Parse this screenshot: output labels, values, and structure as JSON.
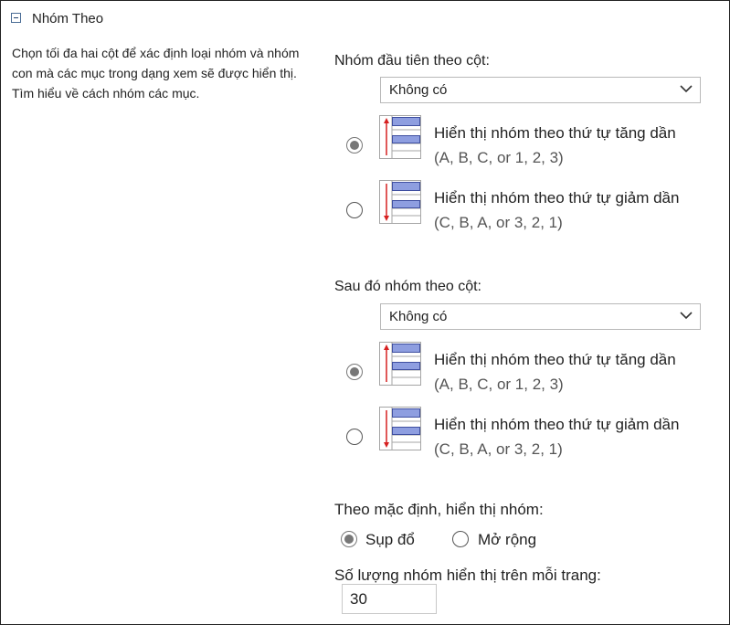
{
  "section": {
    "title": "Nhóm Theo",
    "description": "Chọn tối đa hai cột để xác định loại nhóm và nhóm con mà các mục trong dạng xem sẽ được hiển thị. Tìm hiểu về cách nhóm các mục."
  },
  "first_group": {
    "label": "Nhóm đầu tiên theo cột:",
    "selected": "Không có",
    "ascending": {
      "line1": "Hiển thị nhóm theo thứ tự tăng dần",
      "line2": "(A, B, C, or 1, 2, 3)",
      "checked": true,
      "icon": "sort-ascending-icon"
    },
    "descending": {
      "line1": "Hiển thị nhóm theo thứ tự giảm dần",
      "line2": "(C, B, A, or 3, 2, 1)",
      "checked": false,
      "icon": "sort-descending-icon"
    }
  },
  "second_group": {
    "label": "Sau đó nhóm theo cột:",
    "selected": "Không có",
    "ascending": {
      "line1": "Hiển thị nhóm theo thứ tự tăng dần",
      "line2": "(A, B, C, or 1, 2, 3)",
      "checked": true,
      "icon": "sort-ascending-icon"
    },
    "descending": {
      "line1": "Hiển thị nhóm theo thứ tự giảm dần",
      "line2": "(C, B, A, or 3, 2, 1)",
      "checked": false,
      "icon": "sort-descending-icon"
    }
  },
  "default_display": {
    "label": "Theo mặc định, hiển thị nhóm:",
    "collapsed_label": "Sụp đổ",
    "expanded_label": "Mở rộng",
    "selected": "collapsed"
  },
  "groups_per_page": {
    "label": "Số lượng nhóm hiển thị trên mỗi trang:",
    "value": "30"
  },
  "colors": {
    "icon_band": "#8e9ee0",
    "icon_band_border": "#3f4fa0",
    "arrow": "#d62020",
    "grid_line": "#a5a5a5"
  }
}
